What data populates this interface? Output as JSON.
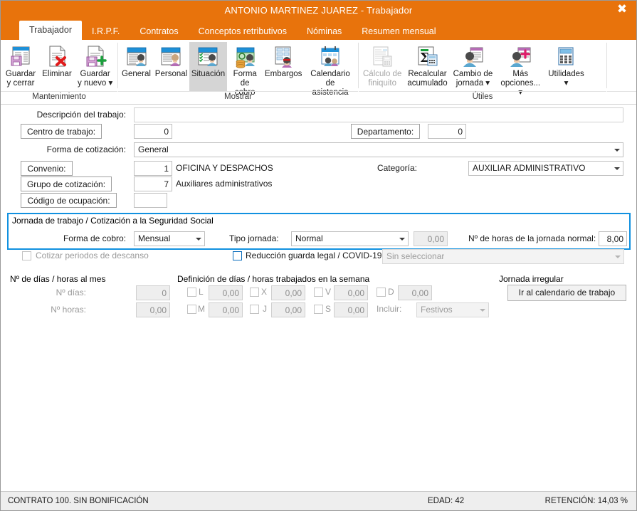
{
  "window": {
    "title": "ANTONIO MARTINEZ JUAREZ - Trabajador",
    "close_label": "✖",
    "accent_color": "#e8730c",
    "highlight_color": "#1191e0"
  },
  "tabs": [
    {
      "label": "Trabajador",
      "active": true
    },
    {
      "label": "I.R.P.F.",
      "active": false
    },
    {
      "label": "Contratos",
      "active": false
    },
    {
      "label": "Conceptos retributivos",
      "active": false
    },
    {
      "label": "Nóminas",
      "active": false
    },
    {
      "label": "Resumen mensual",
      "active": false
    }
  ],
  "ribbon": {
    "groups": [
      {
        "label": "Mantenimiento",
        "items": [
          {
            "label": "Guardar\ny cerrar",
            "icon": "save-close-icon",
            "state": "normal"
          },
          {
            "label": "Eliminar",
            "icon": "delete-icon",
            "state": "normal"
          },
          {
            "label": "Guardar\ny nuevo ▾",
            "icon": "save-new-icon",
            "state": "normal"
          }
        ]
      },
      {
        "label": "Mostrar",
        "items": [
          {
            "label": "General",
            "icon": "general-card-icon",
            "state": "normal"
          },
          {
            "label": "Personal",
            "icon": "personal-card-icon",
            "state": "normal"
          },
          {
            "label": "Situación",
            "icon": "situacion-card-icon",
            "state": "selected"
          },
          {
            "label": "Forma\nde cobro",
            "icon": "payment-coins-icon",
            "state": "normal"
          },
          {
            "label": "Embargos",
            "icon": "garnishment-icon",
            "state": "normal"
          },
          {
            "label": "Calendario\nde asistencia",
            "icon": "attendance-calendar-icon",
            "state": "normal"
          }
        ]
      },
      {
        "label": "Útiles",
        "items": [
          {
            "label": "Cálculo de\nfiniquito",
            "icon": "settlement-calc-icon",
            "state": "disabled"
          },
          {
            "label": "Recalcular\nacumulado",
            "icon": "recalculate-sigma-icon",
            "state": "normal"
          },
          {
            "label": "Cambio de\njornada ▾",
            "icon": "workday-change-icon",
            "state": "normal"
          },
          {
            "label": "Más\nopciones... ▾",
            "icon": "more-options-icon",
            "state": "normal"
          },
          {
            "label": "Utilidades\n▾",
            "icon": "calculator-icon",
            "state": "normal"
          }
        ]
      }
    ]
  },
  "form": {
    "descripcion_label": "Descripción del trabajo:",
    "descripcion_value": "",
    "centro_trabajo_label": "Centro de trabajo:",
    "centro_trabajo_value": "0",
    "departamento_label": "Departamento:",
    "departamento_value": "0",
    "forma_cotizacion_label": "Forma de cotización:",
    "forma_cotizacion_value": "General",
    "convenio_label": "Convenio:",
    "convenio_code": "1",
    "convenio_desc": "OFICINA Y DESPACHOS",
    "categoria_label": "Categoría:",
    "categoria_value": "AUXILIAR ADMINISTRATIVO",
    "grupo_cotizacion_label": "Grupo de cotización:",
    "grupo_cotizacion_code": "7",
    "grupo_cotizacion_desc": "Auxiliares administrativos",
    "codigo_ocupacion_label": "Código de ocupación:",
    "codigo_ocupacion_value": ""
  },
  "jornada": {
    "group_title": "Jornada de trabajo / Cotización a la Seguridad Social",
    "forma_cobro_label": "Forma de cobro:",
    "forma_cobro_value": "Mensual",
    "tipo_jornada_label": "Tipo jornada:",
    "tipo_jornada_value": "Normal",
    "tipo_jornada_pct": "0,00",
    "horas_normal_label": "Nº de horas de la jornada normal:",
    "horas_normal_value": "8,00",
    "cotizar_descanso_label": "Cotizar periodos de descanso",
    "cotizar_descanso_checked": false,
    "reduccion_label": "Reducción guarda legal / COVID-19",
    "reduccion_checked": false,
    "reduccion_select_value": "Sin seleccionar"
  },
  "dias_mes": {
    "section_title": "Nº de días / horas al mes",
    "dias_label": "Nº días:",
    "dias_value": "0",
    "horas_label": "Nº horas:",
    "horas_value": "0,00"
  },
  "semana": {
    "section_title": "Definición de días / horas trabajados en la semana",
    "days": [
      {
        "code": "L",
        "value": "0,00",
        "checked": false
      },
      {
        "code": "M",
        "value": "0,00",
        "checked": false
      },
      {
        "code": "X",
        "value": "0,00",
        "checked": false
      },
      {
        "code": "J",
        "value": "0,00",
        "checked": false
      },
      {
        "code": "V",
        "value": "0,00",
        "checked": false
      },
      {
        "code": "S",
        "value": "0,00",
        "checked": false
      },
      {
        "code": "D",
        "value": "0,00",
        "checked": false
      }
    ],
    "incluir_label": "Incluir:",
    "incluir_value": "Festivos"
  },
  "jornada_irregular": {
    "section_title": "Jornada irregular",
    "button_label": "Ir al calendario de trabajo"
  },
  "statusbar": {
    "left": "CONTRATO 100.  SIN BONIFICACIÓN",
    "middle": "EDAD: 42",
    "right": "RETENCIÓN: 14,03 %"
  }
}
